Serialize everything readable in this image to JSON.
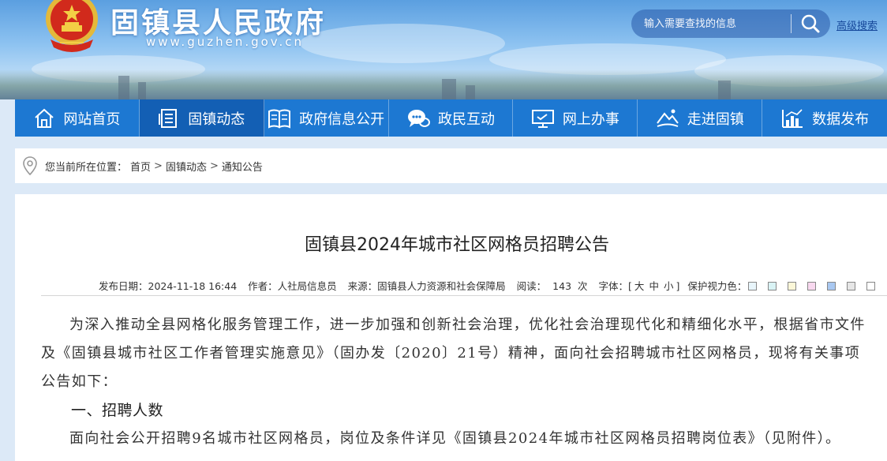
{
  "header": {
    "site_title": "固镇县人民政府",
    "site_url": "www.guzhen.gov.cn",
    "search_placeholder": "输入需要查找的信息",
    "advanced_search": "高级搜索"
  },
  "nav": {
    "items": [
      {
        "label": "网站首页",
        "icon": "home-icon"
      },
      {
        "label": "固镇动态",
        "icon": "news-icon"
      },
      {
        "label": "政府信息公开",
        "icon": "book-icon"
      },
      {
        "label": "政民互动",
        "icon": "chat-icon"
      },
      {
        "label": "网上办事",
        "icon": "monitor-icon"
      },
      {
        "label": "走进固镇",
        "icon": "landscape-icon"
      },
      {
        "label": "数据发布",
        "icon": "bar-chart-icon"
      }
    ],
    "active_index": 1
  },
  "breadcrumb": {
    "prefix": "您当前所在位置：",
    "items": [
      "首页",
      "固镇动态",
      "通知公告"
    ],
    "separator": ">"
  },
  "article": {
    "title": "固镇县2024年城市社区网格员招聘公告",
    "meta": {
      "published": "发布日期：2024-11-18 16:44",
      "author": "作者：人社局信息员",
      "source": "来源：固镇县人力资源和社会保障局",
      "reads_label": "阅读：",
      "reads_count": "143",
      "reads_unit": "次",
      "font_label": "字体：[",
      "font_sizes": [
        "大",
        "中",
        "小"
      ],
      "font_close": "]",
      "eye_care_label": "保护视力色："
    },
    "swatch_colors": [
      "#e8f5fb",
      "#d9f3f5",
      "#fbf7d8",
      "#f8d8ef",
      "#a9c8f1",
      "#e6e6e6",
      "#ffffff"
    ],
    "paragraph_1": "为深入推动全县网格化服务管理工作，进一步加强和创新社会治理，优化社会治理现代化和精细化水平，根据省市文件及《固镇县城市社区工作者管理实施意见》（固办发〔2020〕21号）精神，面向社会招聘城市社区网格员，现将有关事项公告如下：",
    "heading_1": "一、招聘人数",
    "paragraph_2": "面向社会公开招聘9名城市社区网格员，岗位及条件详见《固镇县2024年城市社区网格员招聘岗位表》（见附件）。"
  }
}
